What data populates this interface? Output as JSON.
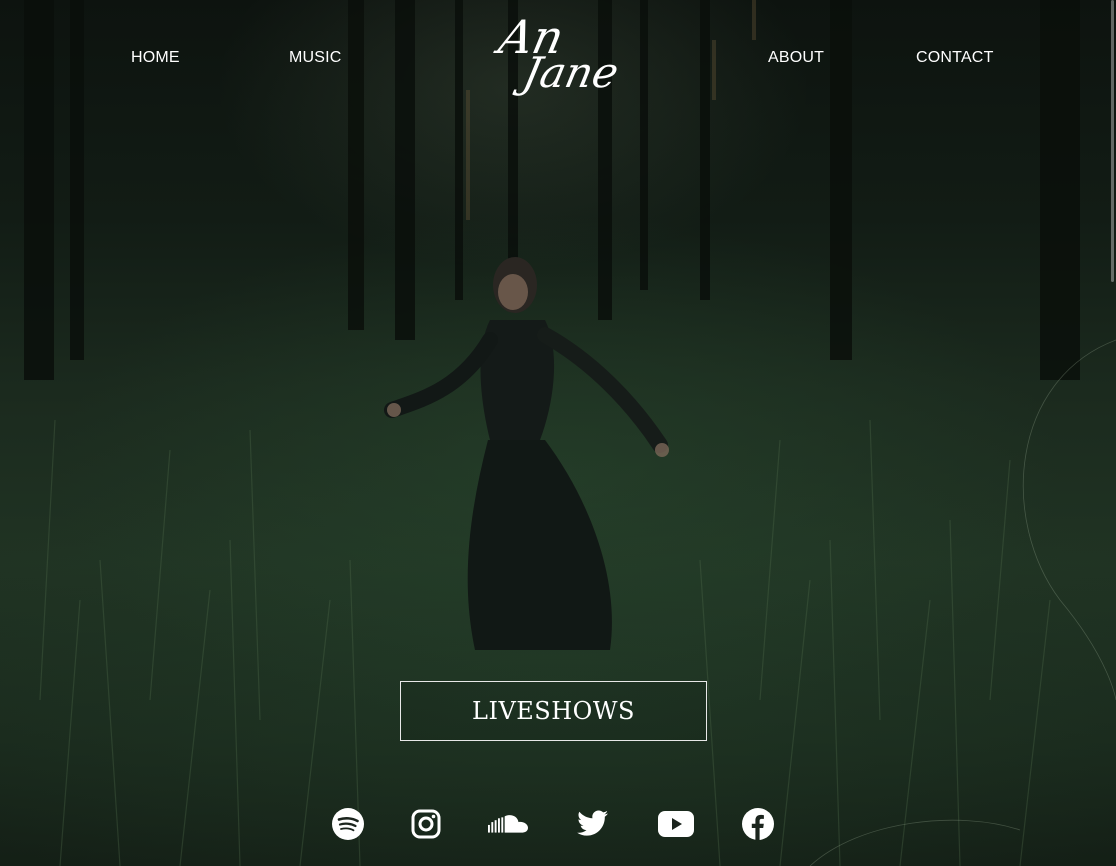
{
  "nav": {
    "home": "HOME",
    "music": "MUSIC",
    "about": "ABOUT",
    "contact": "CONTACT"
  },
  "logo": {
    "line1": "An",
    "line2": "Jane"
  },
  "cta": {
    "label": "LIVESHOWS"
  },
  "social": [
    {
      "name": "spotify-icon"
    },
    {
      "name": "instagram-icon"
    },
    {
      "name": "soundcloud-icon"
    },
    {
      "name": "twitter-icon"
    },
    {
      "name": "youtube-icon"
    },
    {
      "name": "facebook-icon"
    }
  ],
  "colors": {
    "text": "#ffffff",
    "background": "#121a14",
    "button_border": "#e8e8e8"
  }
}
